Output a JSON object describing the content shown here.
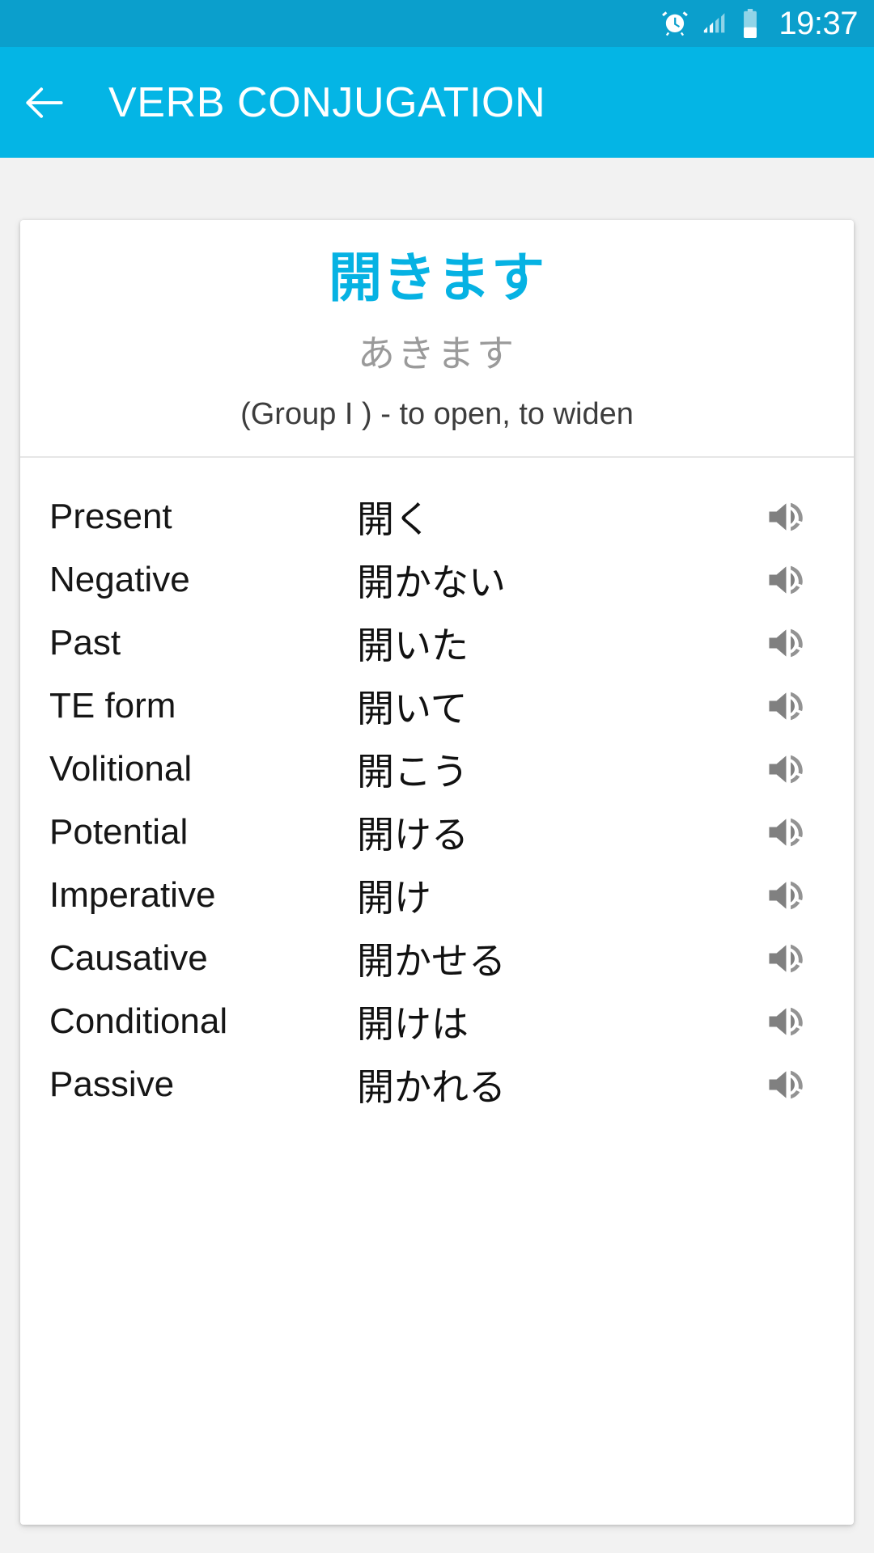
{
  "status_bar": {
    "time": "19:37",
    "icons": [
      "alarm-icon",
      "signal-icon",
      "battery-icon"
    ],
    "background_color": "#0b9fcc"
  },
  "app_bar": {
    "title": "VERB CONJUGATION",
    "back_icon": "arrow-left-icon",
    "background_color": "#04b5e5",
    "text_color": "#ffffff"
  },
  "card": {
    "verb": "開きます",
    "verb_color": "#06b2e3",
    "reading": "あきます",
    "reading_color": "#9a9a9a",
    "meaning": "(Group I ) - to open, to widen",
    "rows": [
      {
        "label": "Present",
        "form": "開く",
        "audio_icon": "speaker-icon"
      },
      {
        "label": "Negative",
        "form": "開かない",
        "audio_icon": "speaker-icon"
      },
      {
        "label": "Past",
        "form": "開いた",
        "audio_icon": "speaker-icon"
      },
      {
        "label": "TE form",
        "form": "開いて",
        "audio_icon": "speaker-icon"
      },
      {
        "label": "Volitional",
        "form": "開こう",
        "audio_icon": "speaker-icon"
      },
      {
        "label": "Potential",
        "form": "開ける",
        "audio_icon": "speaker-icon"
      },
      {
        "label": "Imperative",
        "form": "開け",
        "audio_icon": "speaker-icon"
      },
      {
        "label": "Causative",
        "form": "開かせる",
        "audio_icon": "speaker-icon"
      },
      {
        "label": "Conditional",
        "form": "開けは",
        "audio_icon": "speaker-icon"
      },
      {
        "label": "Passive",
        "form": "開かれる",
        "audio_icon": "speaker-icon"
      }
    ]
  }
}
